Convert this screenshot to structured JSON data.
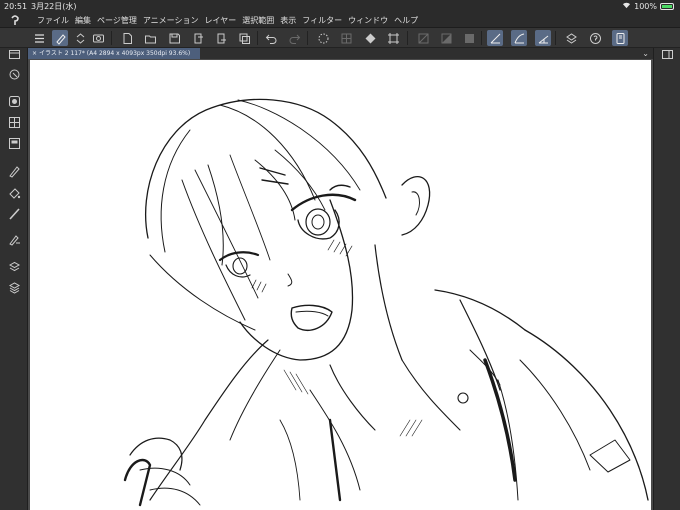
{
  "status": {
    "time": "20:51",
    "date": "3月22日(水)",
    "battery_text": "100%"
  },
  "menu": {
    "items": [
      "ファイル",
      "編集",
      "ページ管理",
      "アニメーション",
      "レイヤー",
      "選択範囲",
      "表示",
      "フィルター",
      "ウィンドウ",
      "ヘルプ"
    ]
  },
  "document": {
    "tab_title": "イラスト 2 117* (A4 2894 x 4093px 350dpi 93.6%)"
  },
  "toolbar": {
    "icons": [
      "menu-icon",
      "pen-tool-icon",
      "up-down-icon",
      "camera-icon",
      "new-file-icon",
      "open-folder-icon",
      "save-icon",
      "export-icon",
      "import-icon",
      "duplicate-icon",
      "undo-icon",
      "redo-icon",
      "loading-icon",
      "grid-icon",
      "fill-icon",
      "transform-icon",
      "ruler-icon",
      "mask-icon",
      "color-icon",
      "snap-ruler-icon",
      "snap-special-icon",
      "snap-grid-icon",
      "stamp-icon",
      "help-icon",
      "panel-icon"
    ]
  },
  "sidebar": {
    "icons": [
      "layer-folder-icon",
      "navigator-icon",
      "brush-size-icon",
      "color-wheel-icon",
      "color-set-icon",
      "pen-tool-icon",
      "fill-tool-icon",
      "brush-icon",
      "text-tool-icon",
      "layer-stack-icon",
      "layers-icon"
    ]
  },
  "colors": {
    "accent": "#5a6b86",
    "tab_active": "#4d5f7c",
    "canvas": "#ffffff",
    "chrome": "#353535"
  }
}
